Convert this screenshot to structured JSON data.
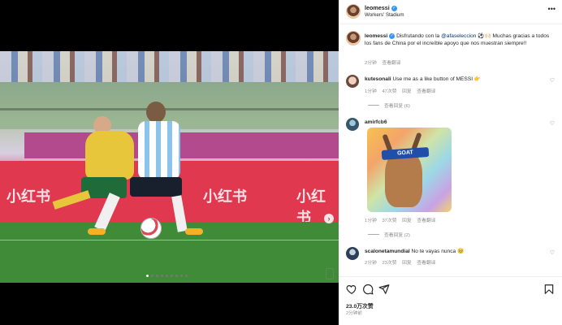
{
  "post": {
    "username": "leomessi",
    "location": "Workers' Stadium",
    "caption_user": "leomessi",
    "caption_mention": "@afaseleccion",
    "caption_before": "Disfrutando con la",
    "caption_after": "⚽🙌🏻 Muchas gracias a todos los fans de China por el increíble apoyo que nos muestran siempre!!",
    "caption_time": "2分钟",
    "caption_translate": "查看翻译",
    "likes": "23.0万次赞",
    "posted_ago": "2分钟前",
    "photo_board_text": [
      "小红书",
      "小红书",
      "小红书"
    ],
    "carousel_dots": 9,
    "carousel_active": 0
  },
  "comments": [
    {
      "username": "kutesonali",
      "text": "Use me as a like button of MESSI 👉",
      "time": "1分钟",
      "likes": "47次赞",
      "reply": "回复",
      "translate": "查看翻译",
      "view_replies": "查看回复 (6)"
    },
    {
      "username": "amirfcb6",
      "image_text": "GOAT",
      "time": "1分钟",
      "likes": "37次赞",
      "reply": "回复",
      "translate": "查看翻译",
      "view_replies": "查看回复 (2)"
    },
    {
      "username": "scalonetamundial",
      "text": "No te vayas nunca 🥺",
      "time": "2分钟",
      "likes": "23次赞",
      "reply": "回复",
      "translate": "查看翻译"
    }
  ],
  "icons": {
    "more": "more-horizontal-icon",
    "heart": "heart-outline-icon",
    "comment": "comment-icon",
    "share": "share-icon",
    "save": "bookmark-icon",
    "verified": "verified-badge-icon",
    "next": "chevron-right-icon"
  },
  "colors": {
    "link": "#00376b",
    "verified": "#3897f0",
    "muted": "#8e8e8e"
  }
}
